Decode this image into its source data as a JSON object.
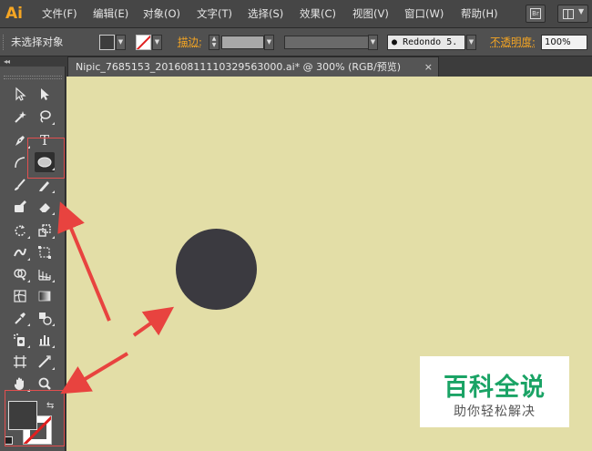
{
  "app": {
    "logo": "Ai"
  },
  "menu": {
    "items": [
      "文件(F)",
      "编辑(E)",
      "对象(O)",
      "文字(T)",
      "选择(S)",
      "效果(C)",
      "视图(V)",
      "窗口(W)",
      "帮助(H)"
    ],
    "bridge_button": "Br"
  },
  "control_bar": {
    "selection_status": "未选择对象",
    "stroke_label": "描边:",
    "brush_name": "Redondo 5.",
    "opacity_label": "不透明度:",
    "opacity_value": "100%"
  },
  "document": {
    "tab_title": "Nipic_7685153_20160811110329563000.ai* @ 300% (RGB/预览)",
    "close_glyph": "×",
    "canvas_color": "#e3dea7",
    "shape_color": "#3b3a40"
  },
  "tools": {
    "selected": "ellipse-tool",
    "text_glyph": "T",
    "collapse_glyph": "◂◂",
    "swap_glyph": "⇆"
  },
  "colors": {
    "fill": "#3d3d3d",
    "stroke": "none",
    "accent_orange": "#f6a623",
    "highlight_red": "#e24f4f"
  },
  "watermark": {
    "title": "百科全说",
    "subtitle": "助你轻松解决"
  }
}
